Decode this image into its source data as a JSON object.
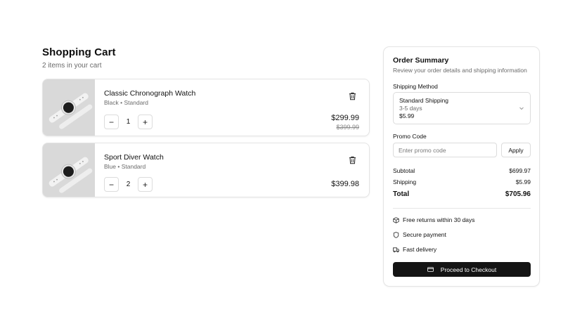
{
  "cart": {
    "title": "Shopping Cart",
    "subtitle": "2 items in your cart",
    "items": [
      {
        "name": "Classic Chronograph Watch",
        "variant": "Black • Standard",
        "quantity": "1",
        "price": "$299.99",
        "original_price": "$399.99",
        "image_icon": "watch-image"
      },
      {
        "name": "Sport Diver Watch",
        "variant": "Blue • Standard",
        "quantity": "2",
        "price": "$399.98",
        "image_icon": "watch-image"
      }
    ],
    "minus_symbol": "−",
    "plus_symbol": "+"
  },
  "summary": {
    "title": "Order Summary",
    "subtitle": "Review your order details and shipping information",
    "shipping_label": "Shipping Method",
    "shipping_selected": {
      "name": "Standard Shipping",
      "days": "3-5 days",
      "price": "$5.99"
    },
    "promo_label": "Promo Code",
    "promo_placeholder": "Enter promo code",
    "promo_value": "",
    "apply_label": "Apply",
    "subtotal_label": "Subtotal",
    "subtotal_value": "$699.97",
    "shipping_row_label": "Shipping",
    "shipping_row_value": "$5.99",
    "total_label": "Total",
    "total_value": "$705.96",
    "features": [
      {
        "label": "Free returns within 30 days",
        "icon": "package-icon"
      },
      {
        "label": "Secure payment",
        "icon": "shield-icon"
      },
      {
        "label": "Fast delivery",
        "icon": "truck-icon"
      }
    ],
    "checkout_label": "Proceed to Checkout"
  },
  "colors": {
    "primary_button": "#141414",
    "muted_text": "#6b6b6b",
    "border": "#e4e4e4",
    "thumb_bg": "#d9d9d9"
  }
}
